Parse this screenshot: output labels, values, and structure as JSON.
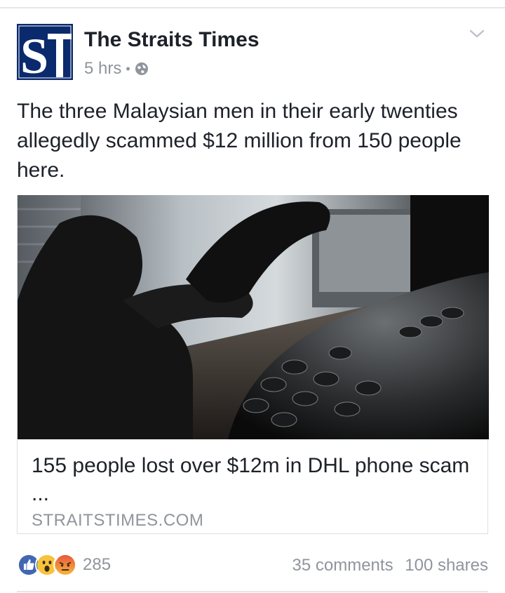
{
  "post": {
    "page_name": "The Straits Times",
    "time": "5 hrs",
    "separator": "•",
    "privacy_icon": "globe-icon",
    "text": "The three Malaysian men in their early twenties allegedly scammed $12 million from 150 people here."
  },
  "link": {
    "title": "155 people lost over $12m in DHL phone scam ...",
    "domain": "STRAITSTIMES.COM",
    "image": "silhouette-holding-phone-receiver"
  },
  "footer": {
    "reactions": [
      "like-icon",
      "wow-icon",
      "angry-icon"
    ],
    "reaction_count": "285",
    "comments": "35 comments",
    "shares": "100 shares"
  },
  "colors": {
    "logo_bg": "#0b2a6d",
    "text": "#1d2129",
    "meta": "#90949c",
    "like_blue": "#4267b2"
  }
}
